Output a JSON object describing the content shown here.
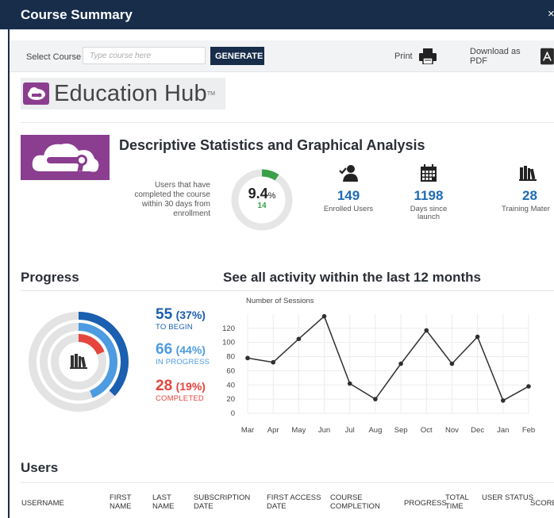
{
  "window": {
    "title": "Course Summary",
    "close_glyph": "×"
  },
  "toolbar": {
    "select_label": "Select Course",
    "course_placeholder": "Type course here",
    "generate_label": "GENERATE",
    "print_label": "Print",
    "pdf_label": "Download as PDF"
  },
  "brand": {
    "name": "Education Hub",
    "tm": "TM",
    "color": "#8b3d8f"
  },
  "stats": {
    "title": "Descriptive Statistics and Graphical Analysis",
    "completed_text": "Users that have completed the course within 30 days from enrollment",
    "completion_pct": "9.4",
    "completion_pct_unit": "%",
    "completion_fraction": 0.094,
    "completion_count": "14",
    "enrolled": {
      "value": "149",
      "label": "Enrolled Users",
      "icon": "user-check-icon"
    },
    "days": {
      "value": "1198",
      "label": "Days since launch",
      "icon": "calendar-icon"
    },
    "materials": {
      "value": "28",
      "label": "Training Mater",
      "icon": "books-icon"
    }
  },
  "progress": {
    "title": "Progress",
    "to_begin": {
      "count": "55",
      "pct": "(37%)",
      "label": "TO BEGIN",
      "fraction": 0.37,
      "color": "#1a5fb0"
    },
    "in_progress": {
      "count": "66",
      "pct": "(44%)",
      "label": "IN PROGRESS",
      "fraction": 0.44,
      "color": "#4d9be0"
    },
    "completed": {
      "count": "28",
      "pct": "(19%)",
      "label": "COMPLETED",
      "fraction": 0.19,
      "color": "#e5453d"
    }
  },
  "activity": {
    "title": "See all activity within the last 12 months"
  },
  "chart_data": {
    "type": "line",
    "title": "",
    "ylabel": "Number of Sessions",
    "xlabel": "",
    "ylim": [
      0,
      140
    ],
    "yticks": [
      "0",
      "20",
      "40",
      "60",
      "80",
      "100",
      "120"
    ],
    "categories": [
      "Mar",
      "Apr",
      "May",
      "Jun",
      "Jul",
      "Aug",
      "Sep",
      "Oct",
      "Nov",
      "Dec",
      "Jan",
      "Feb"
    ],
    "values": [
      78,
      72,
      105,
      137,
      42,
      20,
      70,
      117,
      70,
      108,
      18,
      38
    ],
    "grid": true,
    "line_color": "#2f2f2f"
  },
  "users": {
    "title": "Users",
    "columns": [
      "USERNAME",
      "FIRST NAME",
      "LAST NAME",
      "SUBSCRIPTION DATE",
      "FIRST ACCESS DATE",
      "COURSE COMPLETION",
      "PROGRESS",
      "TOTAL TIME",
      "USER STATUS",
      "SCORE"
    ]
  }
}
